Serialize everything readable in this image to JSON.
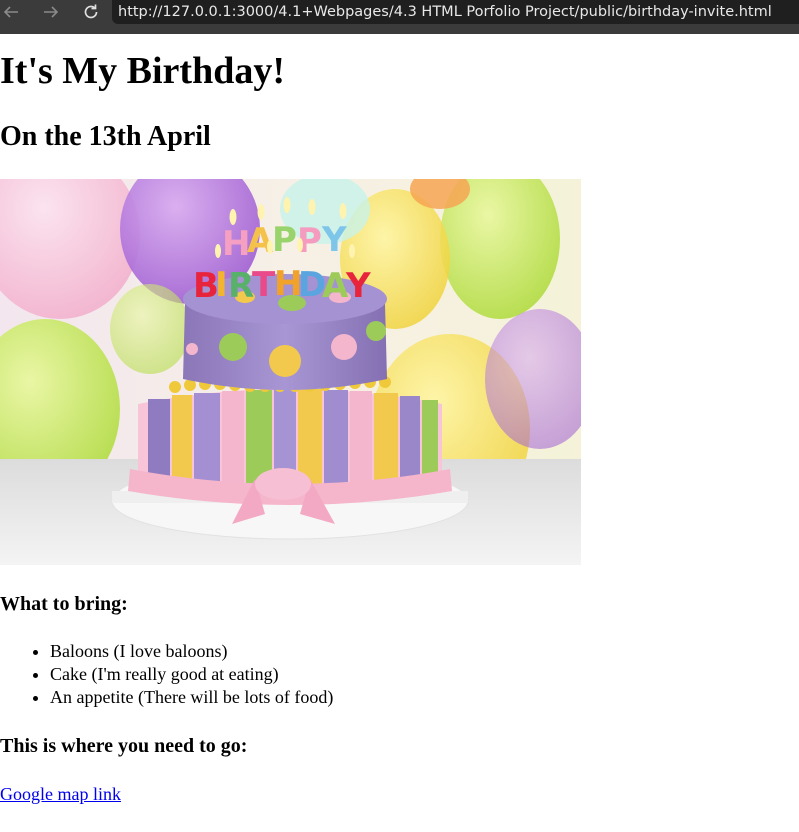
{
  "browser": {
    "url": "http://127.0.0.1:3000/4.1+Webpages/4.3 HTML Porfolio Project/public/birthday-invite.html"
  },
  "page": {
    "title": "It's My Birthday!",
    "date": "On the 13th April",
    "image": {
      "description": "Two-tier purple birthday cake with candles",
      "candle_text_top": "HAPPY",
      "candle_text_bottom": "BIRTHDAY"
    },
    "bring_heading": "What to bring:",
    "bring_items": [
      "Baloons (I love baloons)",
      "Cake (I'm really good at eating)",
      "An appetite (There will be lots of food)"
    ],
    "location_heading": "This is where you need to go:",
    "map_link": "Google map link"
  },
  "colors": {
    "toolbar_bg": "#3b3b3b",
    "address_bg": "#1f1f1f",
    "link": "#0000ee",
    "cake_purple": "#9a85c9",
    "cake_pink": "#f4b6cc",
    "cake_yellow": "#f2c94c",
    "cake_green": "#9ccb5a"
  },
  "icons": {
    "back": "arrow-left-icon",
    "forward": "arrow-right-icon",
    "reload": "reload-icon"
  }
}
